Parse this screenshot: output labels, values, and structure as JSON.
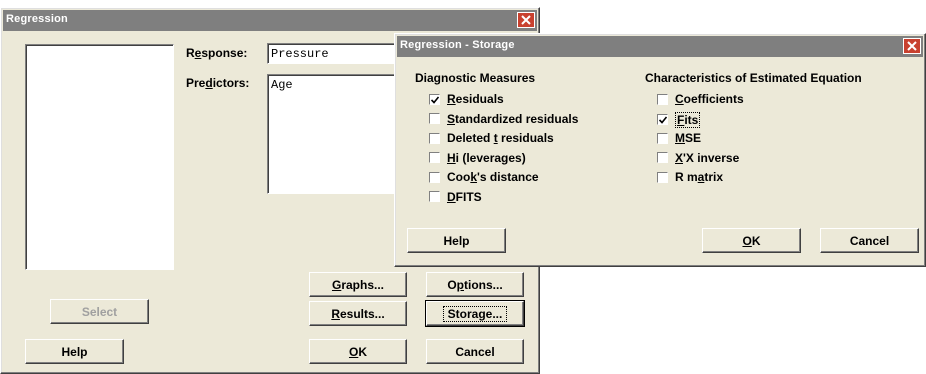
{
  "regression": {
    "title": "Regression",
    "response_label_pre": "R",
    "response_label_u": "e",
    "response_label_post": "sponse:",
    "response_value": "Pressure",
    "predictors_label_pre": "Pre",
    "predictors_label_u": "d",
    "predictors_label_post": "ictors:",
    "predictors_value": "Age",
    "buttons": {
      "select": "Select",
      "help": "Help",
      "graphs_u": "G",
      "graphs_rest": "raphs...",
      "options_pre": "O",
      "options_u": "p",
      "options_rest": "tions...",
      "results_u": "R",
      "results_rest": "esults...",
      "storage": "Storage...",
      "ok_u": "O",
      "ok_rest": "K",
      "cancel": "Cancel"
    }
  },
  "storage": {
    "title": "Regression - Storage",
    "diagnostic_heading": "Diagnostic Measures",
    "characteristics_heading": "Characteristics of Estimated Equation",
    "diagnostic": [
      {
        "pre": "",
        "u": "R",
        "post": "esiduals",
        "checked": true
      },
      {
        "pre": "",
        "u": "S",
        "post": "tandardized residuals",
        "checked": false
      },
      {
        "pre": "Deleted ",
        "u": "t",
        "post": " residuals",
        "checked": false
      },
      {
        "pre": "",
        "u": "H",
        "post": "i (leverages)",
        "checked": false
      },
      {
        "pre": "Coo",
        "u": "k",
        "post": "'s distance",
        "checked": false
      },
      {
        "pre": "",
        "u": "D",
        "post": "FITS",
        "checked": false
      }
    ],
    "characteristics": [
      {
        "pre": "",
        "u": "C",
        "post": "oefficients",
        "checked": false
      },
      {
        "pre": "",
        "u": "F",
        "post": "its",
        "checked": true,
        "focused": true
      },
      {
        "pre": "",
        "u": "M",
        "post": "SE",
        "checked": false
      },
      {
        "pre": "",
        "u": "X",
        "post": "'X inverse",
        "checked": false
      },
      {
        "pre": "R m",
        "u": "a",
        "post": "trix",
        "checked": false
      }
    ],
    "buttons": {
      "help": "Help",
      "ok_u": "O",
      "ok_rest": "K",
      "cancel": "Cancel"
    }
  },
  "colors": {
    "dialog_face": "#ece9d8",
    "titlebar": "#7f7f7f",
    "close_button": "#c8412f"
  },
  "icons": {
    "close": "close-icon",
    "checkmark": "checkmark-icon"
  }
}
